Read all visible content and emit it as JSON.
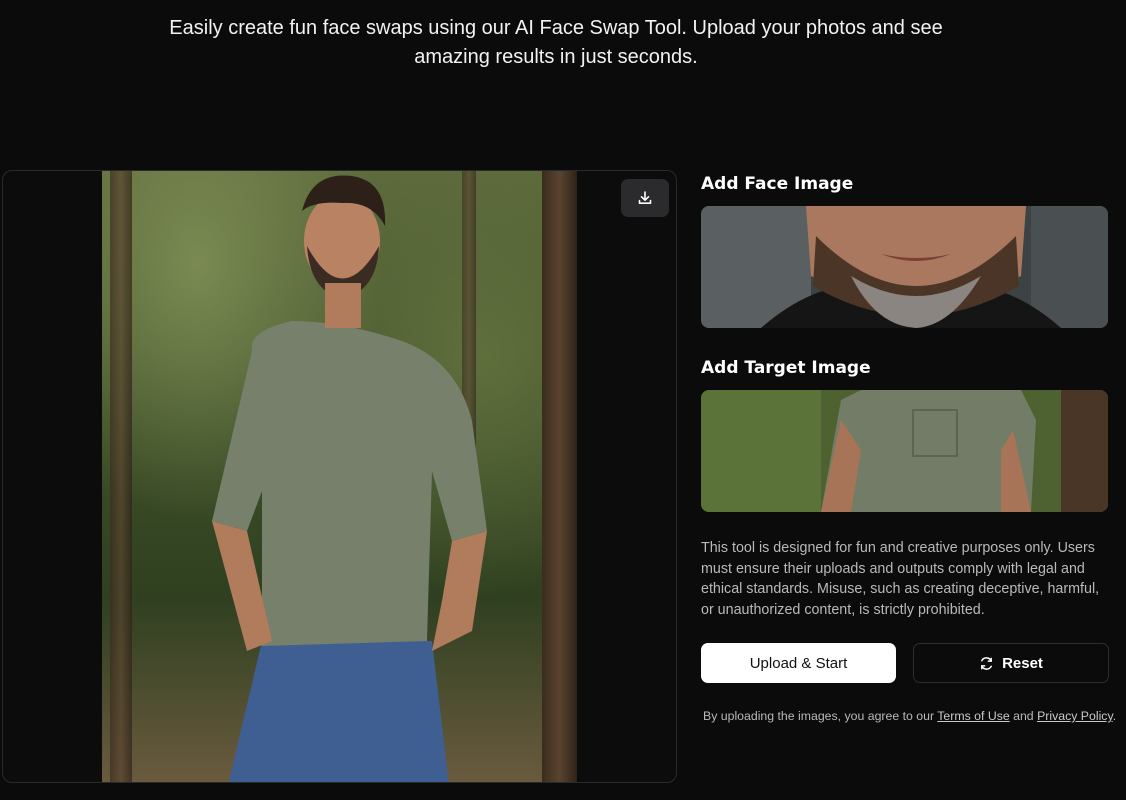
{
  "intro": {
    "line1": "Easily create fun face swaps using our AI Face Swap Tool. Upload your photos and see",
    "line2": "amazing results in just seconds."
  },
  "preview": {
    "download_icon": "download-icon"
  },
  "face_section": {
    "title": "Add Face Image"
  },
  "target_section": {
    "title": "Add Target Image"
  },
  "disclaimer": "This tool is designed for fun and creative purposes only. Users must ensure their uploads and outputs comply with legal and ethical standards. Misuse, such as creating deceptive, harmful, or unauthorized content, is strictly prohibited.",
  "buttons": {
    "upload_label": "Upload & Start",
    "reset_label": "Reset",
    "reset_icon": "refresh-icon"
  },
  "agreement": {
    "prefix": "By uploading the images, you agree to our ",
    "terms_label": "Terms of Use",
    "and": " and ",
    "privacy_label": "Privacy Policy",
    "suffix": "."
  },
  "colors": {
    "background": "#0b0b0c",
    "panel_border": "#2a2a2c",
    "button_light": "#ffffff",
    "muted_text": "#b9b9bc"
  }
}
